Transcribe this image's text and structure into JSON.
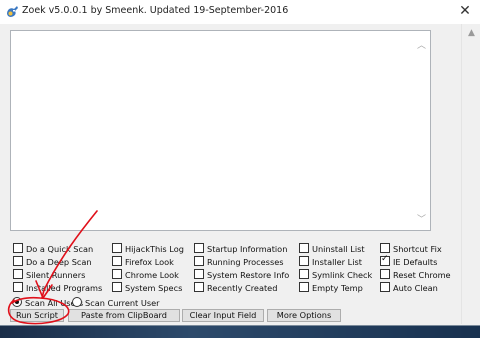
{
  "window": {
    "title": "Zoek v5.0.0.1 by Smeenk. Updated 19-September-2016",
    "close_glyph": "✕"
  },
  "options": [
    {
      "label": "Do a Quick Scan",
      "checked": false
    },
    {
      "label": "HijackThis Log",
      "checked": false
    },
    {
      "label": "Startup Information",
      "checked": false
    },
    {
      "label": "Uninstall List",
      "checked": false
    },
    {
      "label": "Shortcut Fix",
      "checked": false
    },
    {
      "label": "Do a Deep Scan",
      "checked": false
    },
    {
      "label": "Firefox Look",
      "checked": false
    },
    {
      "label": "Running Processes",
      "checked": false
    },
    {
      "label": "Installer List",
      "checked": false
    },
    {
      "label": "IE Defaults",
      "checked": true
    },
    {
      "label": "Silent Runners",
      "checked": false
    },
    {
      "label": "Chrome Look",
      "checked": false
    },
    {
      "label": "System Restore Info",
      "checked": false
    },
    {
      "label": "Symlink Check",
      "checked": false
    },
    {
      "label": "Reset Chrome",
      "checked": false
    },
    {
      "label": "Installed Programs",
      "checked": false
    },
    {
      "label": "System Specs",
      "checked": false
    },
    {
      "label": "Recently Created",
      "checked": false
    },
    {
      "label": "Empty Temp",
      "checked": false
    },
    {
      "label": "Auto Clean",
      "checked": false
    }
  ],
  "scan_scope": {
    "all_users": "Scan All Users",
    "current_user": "Scan Current User",
    "selected": "all_users"
  },
  "buttons": {
    "run_script": "Run Script",
    "paste_clipboard": "Paste from ClipBoard",
    "clear_input": "Clear Input Field",
    "more_options": "More Options"
  },
  "annotation_color": "#e0101a"
}
